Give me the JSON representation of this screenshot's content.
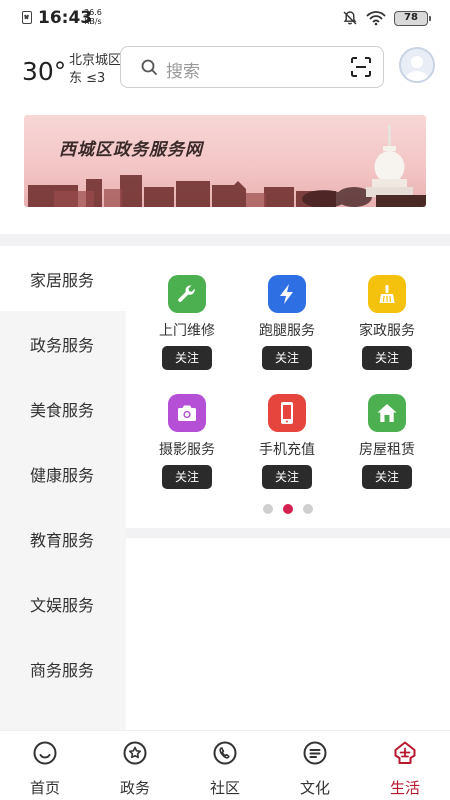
{
  "status_bar": {
    "time": "16:43",
    "net_speed_value": "36.6",
    "net_speed_unit": "KB/s",
    "battery": "78"
  },
  "header": {
    "temperature": "30°",
    "district": "北京城区",
    "wind": "东 ≤3",
    "search_placeholder": "搜索"
  },
  "banner": {
    "title": "西城区政务服务网"
  },
  "categories": [
    {
      "label": "家居服务",
      "active": true
    },
    {
      "label": "政务服务"
    },
    {
      "label": "美食服务"
    },
    {
      "label": "健康服务"
    },
    {
      "label": "教育服务"
    },
    {
      "label": "文娱服务"
    },
    {
      "label": "商务服务"
    }
  ],
  "services": [
    {
      "label": "上门维修",
      "icon": "wrench-icon",
      "color": "#4caf50",
      "button": "关注"
    },
    {
      "label": "跑腿服务",
      "icon": "lightning-icon",
      "color": "#2f6fe4",
      "button": "关注"
    },
    {
      "label": "家政服务",
      "icon": "broom-icon",
      "color": "#f4c20d",
      "button": "关注"
    },
    {
      "label": "摄影服务",
      "icon": "camera-icon",
      "color": "#b44fd6",
      "button": "关注"
    },
    {
      "label": "手机充值",
      "icon": "phone-icon",
      "color": "#e5453c",
      "button": "关注"
    },
    {
      "label": "房屋租赁",
      "icon": "house-icon",
      "color": "#4caf50",
      "button": "关注"
    }
  ],
  "pager": {
    "count": 3,
    "active_index": 1
  },
  "tabs": [
    {
      "label": "首页",
      "icon": "home-icon"
    },
    {
      "label": "政务",
      "icon": "gov-icon"
    },
    {
      "label": "社区",
      "icon": "community-icon"
    },
    {
      "label": "文化",
      "icon": "culture-icon"
    },
    {
      "label": "生活",
      "icon": "life-icon",
      "active": true
    }
  ],
  "colors": {
    "accent": "#b8172d",
    "pager_active": "#d6204d",
    "button_dark": "#2b2b2b"
  }
}
